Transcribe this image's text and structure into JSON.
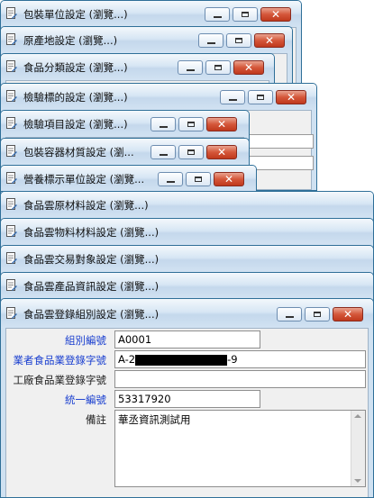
{
  "windows": [
    {
      "title": "包裝單位設定 (瀏覽...)"
    },
    {
      "title": "原產地設定 (瀏覽...)"
    },
    {
      "title": "食品分類設定 (瀏覽...)"
    },
    {
      "title": "檢驗標的設定 (瀏覽...)"
    },
    {
      "title": "檢驗項目設定 (瀏覽...)"
    },
    {
      "title": "包裝容器材質設定 (瀏..."
    },
    {
      "title": "營養標示單位設定 (瀏覽..."
    },
    {
      "title": "食品雲原材料設定 (瀏覽...)"
    },
    {
      "title": "食品雲物料材料設定 (瀏覽...)"
    },
    {
      "title": "食品雲交易對象設定 (瀏覽...)"
    },
    {
      "title": "食品雲產品資訊設定 (瀏覽...)"
    },
    {
      "title": "食品雲登錄組別設定 (瀏覽...)"
    }
  ],
  "form": {
    "group_code_label": "組別編號",
    "group_code_value": "A0001",
    "reg_no_label": "業者食品業登錄字號",
    "reg_no_prefix": "A-2",
    "reg_no_suffix": "-9",
    "factory_reg_label": "工廠食品業登錄字號",
    "factory_reg_value": "",
    "tax_id_label": "統一編號",
    "tax_id_value": "53317920",
    "note_label": "備註",
    "note_value": "華丞資訊測試用"
  },
  "colors": {
    "required_label": "#1a3fcf",
    "close_button": "#c0391d"
  }
}
